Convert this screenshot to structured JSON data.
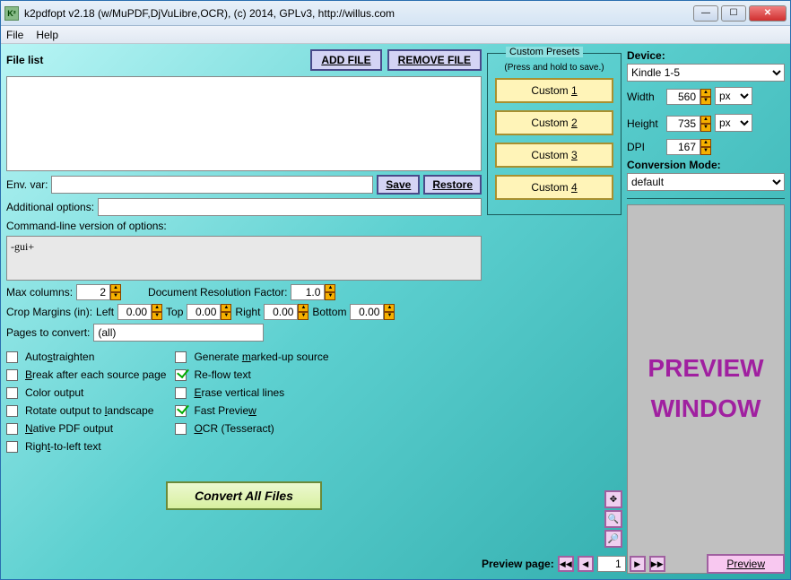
{
  "window": {
    "title": "k2pdfopt v2.18 (w/MuPDF,DjVuLibre,OCR), (c) 2014, GPLv3, http://willus.com"
  },
  "menu": {
    "file": "File",
    "help": "Help"
  },
  "filelist": {
    "label": "File list",
    "add": "ADD FILE",
    "remove": "REMOVE FILE"
  },
  "env": {
    "label": "Env. var:",
    "value": "",
    "save": "Save",
    "restore": "Restore"
  },
  "addopt": {
    "label": "Additional options:",
    "value": ""
  },
  "cmdline": {
    "label": "Command-line version of options:",
    "value": "-gui+"
  },
  "maxcol": {
    "label": "Max columns:",
    "value": "2"
  },
  "drf": {
    "label": "Document Resolution Factor:",
    "value": "1.0"
  },
  "crop": {
    "label": "Crop Margins (in):",
    "left_l": "Left",
    "left_v": "0.00",
    "top_l": "Top",
    "top_v": "0.00",
    "right_l": "Right",
    "right_v": "0.00",
    "bottom_l": "Bottom",
    "bottom_v": "0.00"
  },
  "pages": {
    "label": "Pages to convert:",
    "value": "(all)"
  },
  "checks_left": [
    {
      "label": "Autostraighten",
      "u": "s",
      "on": false
    },
    {
      "label": "Break after each source page",
      "u": "B",
      "on": false
    },
    {
      "label": "Color output",
      "on": false
    },
    {
      "label": "Rotate output to landscape",
      "u": "l",
      "on": false
    },
    {
      "label": "Native PDF output",
      "u": "N",
      "on": false
    },
    {
      "label": "Right-to-left text",
      "u": "t",
      "on": false
    }
  ],
  "checks_right": [
    {
      "label": "Generate marked-up source",
      "u": "m",
      "on": false
    },
    {
      "label": "Re-flow text",
      "on": true
    },
    {
      "label": "Erase vertical lines",
      "u": "E",
      "on": false
    },
    {
      "label": "Fast Preview",
      "u": "w",
      "on": true
    },
    {
      "label": "OCR (Tesseract)",
      "u": "O",
      "on": false
    }
  ],
  "convert": "Convert All Files",
  "presets": {
    "legend": "Custom Presets",
    "hint": "(Press and hold to save.)",
    "items": [
      "Custom 1",
      "Custom 2",
      "Custom 3",
      "Custom 4"
    ]
  },
  "device": {
    "label": "Device:",
    "value": "Kindle 1-5",
    "width_l": "Width",
    "width_v": "560",
    "width_u": "px",
    "height_l": "Height",
    "height_v": "735",
    "height_u": "px",
    "dpi_l": "DPI",
    "dpi_v": "167",
    "mode_l": "Conversion Mode:",
    "mode_v": "default"
  },
  "preview": "PREVIEW\nWINDOW",
  "footer": {
    "label": "Preview page:",
    "page": "1",
    "preview_btn": "Preview"
  }
}
